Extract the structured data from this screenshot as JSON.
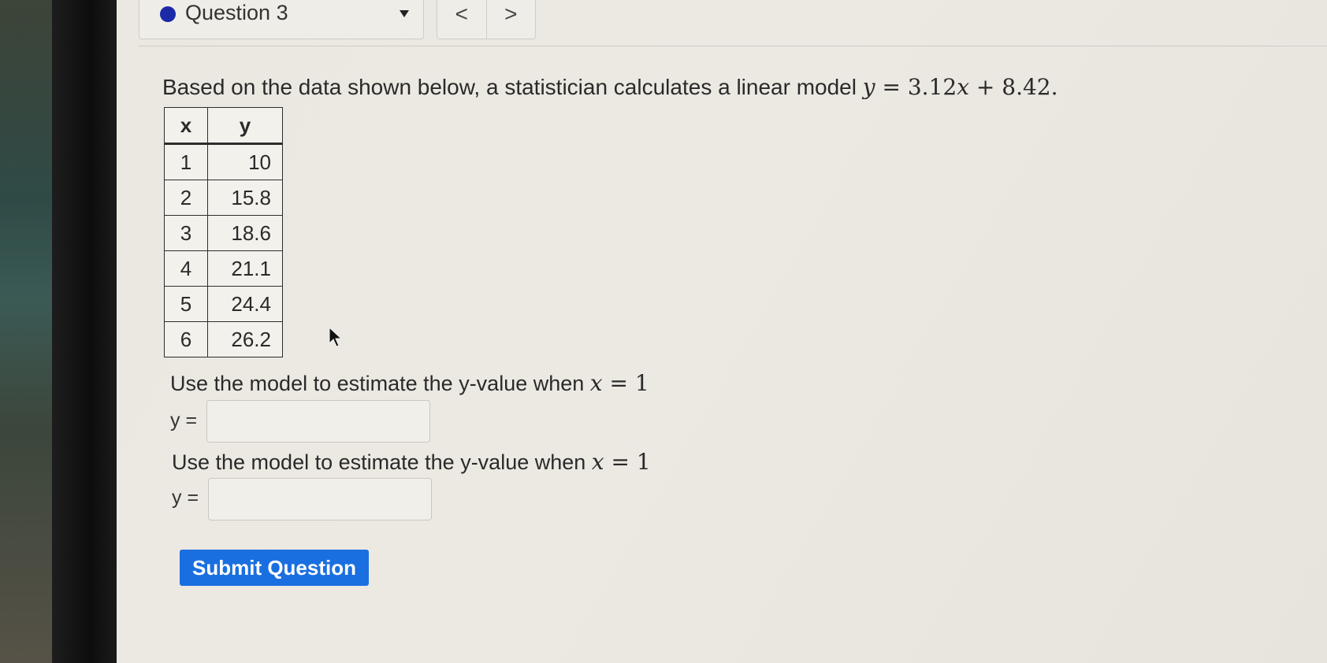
{
  "header": {
    "question_label": "Question 3",
    "prev_label": "<",
    "next_label": ">"
  },
  "question": {
    "prompt_text": "Based on the data shown below, a statistician calculates a linear model ",
    "model": {
      "lhs": "y",
      "eq": " = 3.12",
      "x": "x",
      "rest": " + 8.42."
    }
  },
  "table": {
    "headers": [
      "x",
      "y"
    ],
    "rows": [
      [
        "1",
        "10"
      ],
      [
        "2",
        "15.8"
      ],
      [
        "3",
        "18.6"
      ],
      [
        "4",
        "21.1"
      ],
      [
        "5",
        "24.4"
      ],
      [
        "6",
        "26.2"
      ]
    ]
  },
  "parts": [
    {
      "text": "Use the model to estimate the y-value when ",
      "var": "x",
      "cond": " = 1",
      "answer_label": "y =",
      "answer_value": ""
    },
    {
      "text": "Use the model to estimate the y-value when ",
      "var": "x",
      "cond": " = 1",
      "answer_label": "y =",
      "answer_value": ""
    }
  ],
  "submit_label": "Submit Question",
  "colors": {
    "accent": "#1a6fe0",
    "status_dot": "#1c2aa8"
  }
}
